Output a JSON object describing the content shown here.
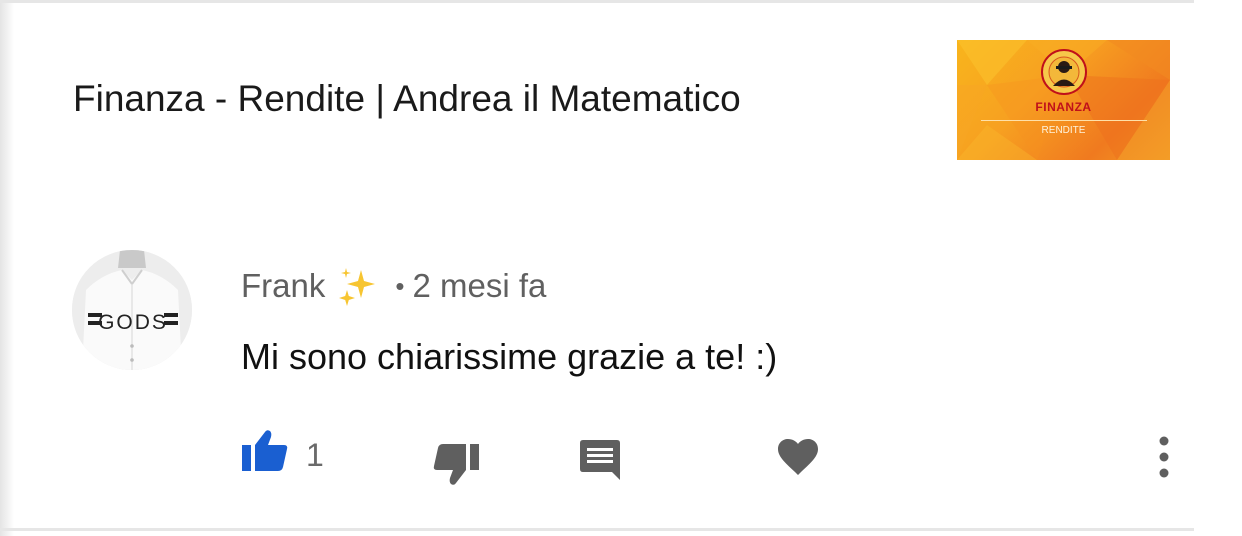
{
  "video": {
    "title": "Finanza - Rendite | Andrea il Matematico",
    "thumbnail": {
      "title": "FINANZA",
      "subtitle": "RENDITE",
      "colors": [
        "#f8b51c",
        "#f07a1f",
        "#c0101a"
      ]
    }
  },
  "comment": {
    "author": "Frank",
    "author_decoration": "sparkles",
    "separator": "•",
    "age": "2 mesi fa",
    "text": "Mi sono chiarissime grazie a te! :)",
    "avatar_print": "GODS",
    "actions": {
      "like_icon": "thumbs-up-icon",
      "like_active_color": "#1a5fd1",
      "like_count": "1",
      "dislike_icon": "thumbs-down-icon",
      "reply_icon": "comment-icon",
      "heart_icon": "heart-icon",
      "more_icon": "more-vert-icon"
    }
  }
}
